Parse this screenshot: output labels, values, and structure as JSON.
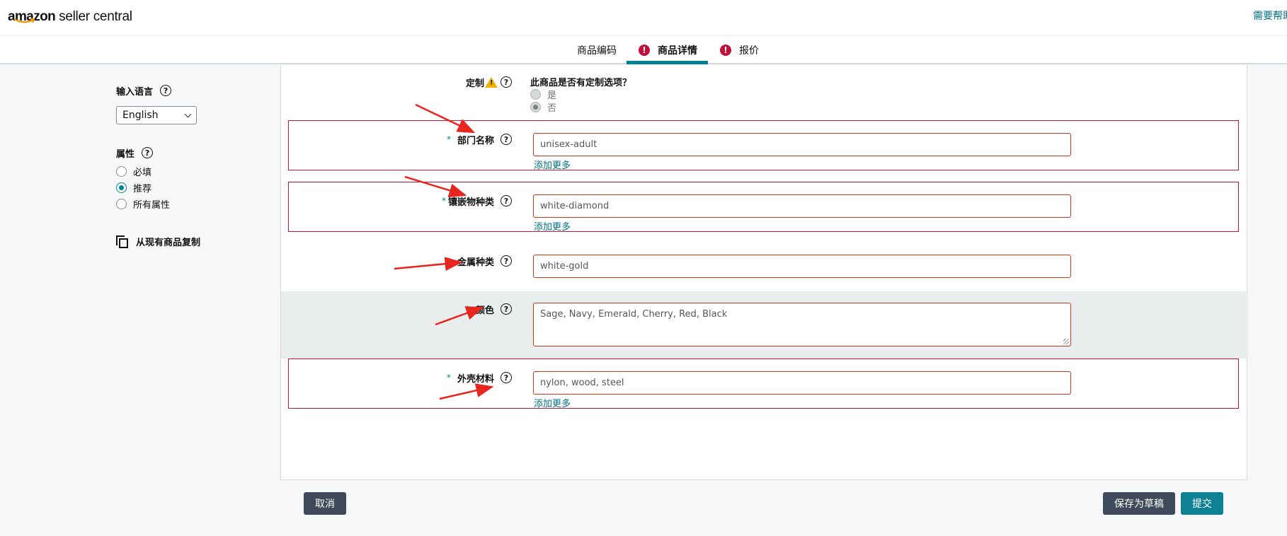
{
  "header": {
    "logo_brand": "amazon",
    "logo_product": "seller central",
    "help_link": "需要帮助"
  },
  "tabs": [
    {
      "label": "商品编码",
      "error": false,
      "active": false
    },
    {
      "label": "商品详情",
      "error": true,
      "active": true
    },
    {
      "label": "报价",
      "error": true,
      "active": false
    }
  ],
  "sidebar": {
    "language_label": "输入语言",
    "language_value": "English",
    "attributes_label": "属性",
    "attribute_options": [
      {
        "label": "必填",
        "checked": false
      },
      {
        "label": "推荐",
        "checked": true
      },
      {
        "label": "所有属性",
        "checked": false
      }
    ],
    "copy_label": "从现有商品复制"
  },
  "form": {
    "customization": {
      "label": "定制",
      "question": "此商品是否有定制选项？",
      "options": [
        {
          "label": "是",
          "checked": false
        },
        {
          "label": "否",
          "checked": true
        }
      ]
    },
    "fields": [
      {
        "label": "部门名称",
        "required": true,
        "value": "unisex-adult",
        "add_more": "添加更多",
        "highlighted": true
      },
      {
        "label": "镶嵌物种类",
        "required": true,
        "value": "white-diamond",
        "add_more": "添加更多",
        "highlighted": true
      },
      {
        "label": "金属种类",
        "required": true,
        "value": "white-gold",
        "highlighted": false
      },
      {
        "label": "颜色",
        "required": true,
        "value": "Sage, Navy, Emerald, Cherry, Red, Black",
        "multiline": true,
        "highlighted": false
      },
      {
        "label": "外壳材料",
        "required": true,
        "value": "nylon, wood, steel",
        "add_more": "添加更多",
        "highlighted": true
      }
    ],
    "required_mark": "*",
    "help_glyph": "?"
  },
  "footer": {
    "cancel": "取消",
    "save_draft": "保存为草稿",
    "submit": "提交"
  },
  "colors": {
    "accent_teal": "#008296",
    "error_red": "#c40f3a",
    "field_error_border": "#c83718",
    "annotation_red": "#e8251f"
  }
}
